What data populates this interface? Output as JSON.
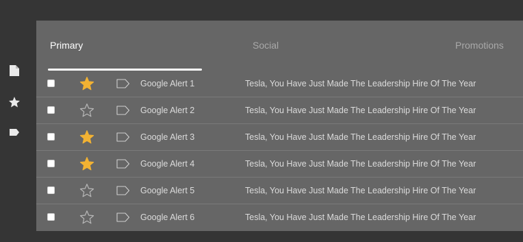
{
  "tabs": [
    {
      "label": "Primary",
      "active": true
    },
    {
      "label": "Social",
      "active": false
    },
    {
      "label": "Promotions",
      "active": false
    }
  ],
  "sidebar": {
    "icons": [
      "file-icon",
      "star-icon",
      "label-icon"
    ]
  },
  "colors": {
    "star_filled": "#f2b233",
    "star_empty": "#b8b8b8",
    "panel": "#666666",
    "background": "#353535"
  },
  "emails": [
    {
      "sender": "Google Alert 1",
      "subject": "Tesla, You Have Just Made The Leadership Hire Of The Year",
      "starred": true,
      "selected": false
    },
    {
      "sender": "Google Alert 2",
      "subject": "Tesla, You Have Just Made The Leadership Hire Of The Year",
      "starred": false,
      "selected": false
    },
    {
      "sender": "Google Alert 3",
      "subject": "Tesla, You Have Just Made The Leadership Hire Of The Year",
      "starred": true,
      "selected": false
    },
    {
      "sender": "Google Alert 4",
      "subject": "Tesla, You Have Just Made The Leadership Hire Of The Year",
      "starred": true,
      "selected": false
    },
    {
      "sender": "Google Alert 5",
      "subject": "Tesla, You Have Just Made The Leadership Hire Of The Year",
      "starred": false,
      "selected": false
    },
    {
      "sender": "Google Alert 6",
      "subject": "Tesla, You Have Just Made The Leadership Hire Of The Year",
      "starred": false,
      "selected": false
    }
  ]
}
